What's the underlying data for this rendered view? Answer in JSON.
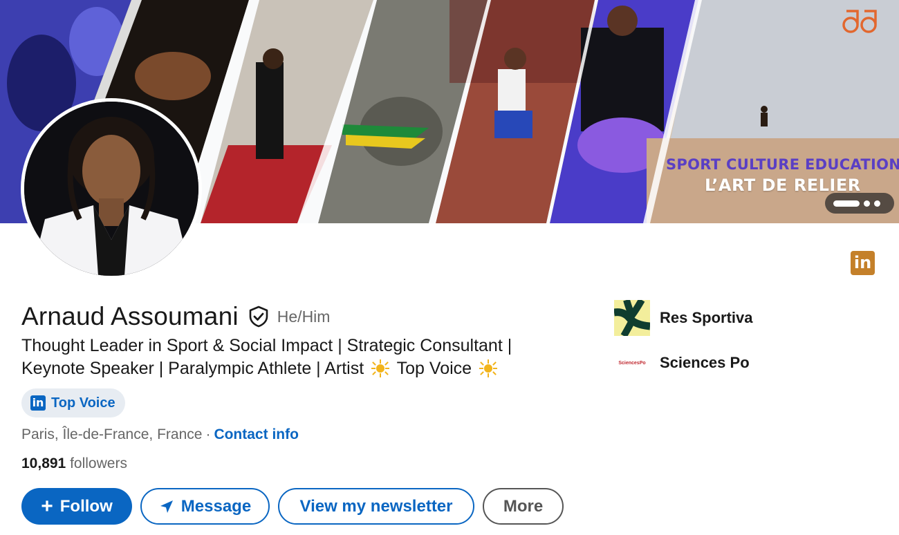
{
  "banner": {
    "tagline_1": "SPORT  CULTURE  EDUCATION",
    "tagline_2": "L’ART DE RELIER",
    "logo_icon": "aa-monogram-logo",
    "carousel_indicator": "carousel-dots"
  },
  "profile": {
    "name": "Arnaud Assoumani",
    "pronouns": "He/Him",
    "headline_part1": "Thought Leader in Sport & Social Impact | Strategic Consultant | Keynote Speaker | Paralympic Athlete | Artist",
    "headline_part2": "Top Voice",
    "badge_label": "Top Voice",
    "location": "Paris, Île-de-France, France",
    "separator": "·",
    "contact_link": "Contact info",
    "followers_count": "10,891",
    "followers_label": "followers"
  },
  "actions": {
    "follow": "Follow",
    "follow_icon": "+",
    "message": "Message",
    "newsletter": "View my newsletter",
    "more": "More"
  },
  "organizations": [
    {
      "name": "Res Sportiva",
      "logo_icon": "res-sportiva-logo"
    },
    {
      "name": "Sciences Po",
      "logo_text": "SciencesPo"
    }
  ],
  "colors": {
    "primary": "#0a66c2",
    "brand_badge": "#c4802a",
    "text_muted": "#666666",
    "badge_bg": "#e7ecf2"
  }
}
